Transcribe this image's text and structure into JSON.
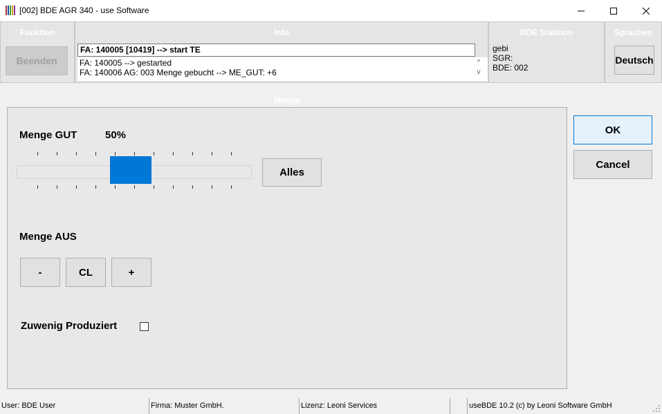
{
  "window": {
    "title": "[002] BDE AGR 340 - use Software",
    "icon": "app-grid-icon",
    "controls": [
      "minimize-icon",
      "maximize-icon",
      "close-icon"
    ]
  },
  "funktion": {
    "title": "Funktion",
    "beenden_label": "Beenden"
  },
  "info": {
    "title": "Info",
    "current": "FA: 140005 [10419] --> start TE",
    "log": [
      "FA: 140005 --> gestarted",
      "FA: 140006 AG: 003 Menge gebucht --> ME_GUT: +6"
    ],
    "scroll_up": "^",
    "scroll_down": "v"
  },
  "station": {
    "title": "BDE Statinon",
    "lines": [
      "gebi",
      "SGR:",
      "BDE: 002"
    ]
  },
  "sprachen": {
    "title": "Sprachen",
    "language_label": "Deutsch"
  },
  "menge": {
    "title": "Menge",
    "gut_label": "Menge GUT",
    "gut_value": "50%",
    "slider_fraction": 0.5,
    "alles_label": "Alles",
    "aus_label": "Menge AUS",
    "minus_label": "-",
    "cl_label": "CL",
    "plus_label": "+",
    "zuwenig_label": "Zuwenig Produziert",
    "zuwenig_checked": false
  },
  "dialog": {
    "ok_label": "OK",
    "cancel_label": "Cancel"
  },
  "accent_color": "#0078d7",
  "statusbar": {
    "user": "User: BDE User",
    "firma": "Firma: Muster GmbH.",
    "lizenz": "Lizenz: Leoni Services",
    "empty": "",
    "copyright": "useBDE 10.2 (c) by Leoni Software GmbH"
  }
}
